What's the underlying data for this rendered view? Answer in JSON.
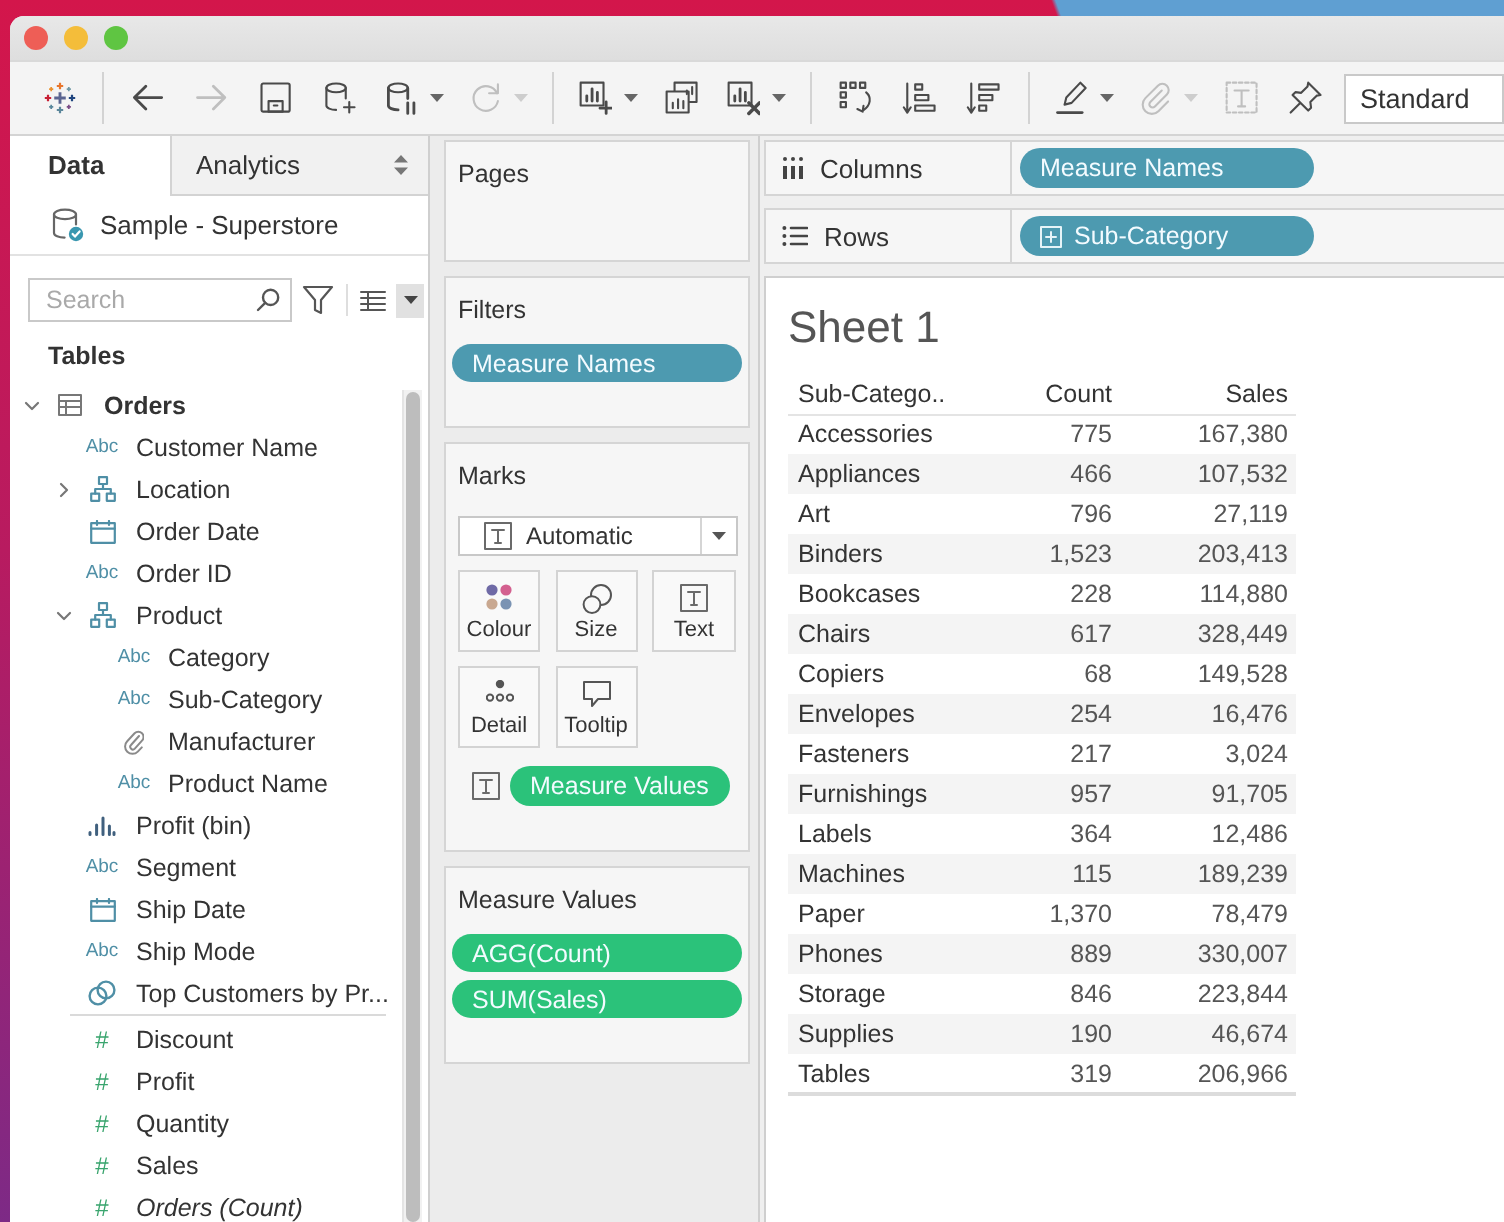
{
  "toolbar": {
    "tool_groups": [
      [
        {
          "kind": "logo",
          "disabled": false,
          "menu": false
        }
      ],
      [
        {
          "kind": "back",
          "disabled": false,
          "menu": false
        },
        {
          "kind": "forward",
          "disabled": true,
          "menu": false
        },
        {
          "kind": "save",
          "disabled": false,
          "menu": false
        },
        {
          "kind": "new_data_source",
          "disabled": false,
          "menu": false
        },
        {
          "kind": "pause_updates",
          "disabled": false,
          "menu": true
        },
        {
          "kind": "refresh",
          "disabled": true,
          "menu": true
        }
      ],
      [
        {
          "kind": "new_worksheet",
          "disabled": false,
          "menu": true
        },
        {
          "kind": "duplicate",
          "disabled": false,
          "menu": false
        },
        {
          "kind": "clear",
          "disabled": false,
          "menu": true
        }
      ],
      [
        {
          "kind": "swap",
          "disabled": false,
          "menu": false
        },
        {
          "kind": "sort_ascending",
          "disabled": false,
          "menu": false
        },
        {
          "kind": "sort_descending",
          "disabled": false,
          "menu": false
        }
      ],
      [
        {
          "kind": "highlight",
          "disabled": false,
          "menu": true
        },
        {
          "kind": "group",
          "disabled": true,
          "menu": true
        },
        {
          "kind": "labels",
          "disabled": true,
          "menu": false
        },
        {
          "kind": "pin",
          "disabled": false,
          "menu": false
        }
      ]
    ],
    "fit": {
      "value": "Standard"
    }
  },
  "data_pane": {
    "tabs": [
      {
        "label": "Data",
        "selected": true
      },
      {
        "label": "Analytics",
        "selected": false
      }
    ],
    "data_source": "Sample - Superstore",
    "search": {
      "placeholder": "Search"
    },
    "heading": "Tables",
    "tables": [
      {
        "name": "Orders",
        "kind": "table",
        "expanded": true,
        "children": [
          {
            "name": "Customer Name",
            "kind": "string",
            "glyph": "Abc"
          },
          {
            "name": "Location",
            "kind": "hierarchy",
            "expanded": false
          },
          {
            "name": "Order Date",
            "kind": "date"
          },
          {
            "name": "Order ID",
            "kind": "string",
            "glyph": "Abc"
          },
          {
            "name": "Product",
            "kind": "hierarchy",
            "expanded": true,
            "children": [
              {
                "name": "Category",
                "kind": "string",
                "glyph": "Abc"
              },
              {
                "name": "Sub-Category",
                "kind": "string",
                "glyph": "Abc"
              },
              {
                "name": "Manufacturer",
                "kind": "group"
              },
              {
                "name": "Product Name",
                "kind": "string",
                "glyph": "Abc"
              }
            ]
          },
          {
            "name": "Profit (bin)",
            "kind": "bin"
          },
          {
            "name": "Segment",
            "kind": "string",
            "glyph": "Abc"
          },
          {
            "name": "Ship Date",
            "kind": "date"
          },
          {
            "name": "Ship Mode",
            "kind": "string",
            "glyph": "Abc"
          },
          {
            "name": "Top Customers by Pr...",
            "kind": "set"
          },
          {
            "name": "Discount",
            "kind": "measure",
            "glyph": "#"
          },
          {
            "name": "Profit",
            "kind": "measure",
            "glyph": "#"
          },
          {
            "name": "Quantity",
            "kind": "measure",
            "glyph": "#"
          },
          {
            "name": "Sales",
            "kind": "measure",
            "glyph": "#"
          },
          {
            "name": "Orders (Count)",
            "kind": "count_measure",
            "glyph": "#"
          }
        ]
      }
    ]
  },
  "cards": [
    {
      "title": "Pages"
    },
    {
      "title": "Filters",
      "pills": [
        {
          "label": "Measure Names",
          "kind": "discrete"
        }
      ]
    },
    {
      "title": "Marks",
      "mark_type": "Automatic",
      "buttons": [
        {
          "label": "Colour",
          "kind": "color"
        },
        {
          "label": "Size",
          "kind": "size"
        },
        {
          "label": "Text",
          "kind": "text"
        },
        {
          "label": "Detail",
          "kind": "detail"
        },
        {
          "label": "Tooltip",
          "kind": "tooltip"
        }
      ],
      "encodings": [
        {
          "kind": "text",
          "pills": [
            {
              "label": "Measure Values",
              "kind": "continuous"
            }
          ]
        }
      ]
    },
    {
      "title": "Measure Values",
      "pills": [
        {
          "label": "AGG(Count)",
          "kind": "continuous"
        },
        {
          "label": "SUM(Sales)",
          "kind": "continuous"
        }
      ]
    }
  ],
  "shelves": [
    {
      "label": "Columns",
      "kind": "columns",
      "pills": [
        {
          "label": "Measure Names",
          "kind": "discrete",
          "expandable": false
        }
      ]
    },
    {
      "label": "Rows",
      "kind": "rows",
      "pills": [
        {
          "label": "Sub-Category",
          "kind": "discrete",
          "expandable": true
        }
      ]
    }
  ],
  "sheet": {
    "title": "Sheet 1",
    "table": {
      "columns": [
        "Sub-Catego..",
        "Count",
        "Sales"
      ],
      "rows": [
        [
          "Accessories",
          "775",
          "167,380"
        ],
        [
          "Appliances",
          "466",
          "107,532"
        ],
        [
          "Art",
          "796",
          "27,119"
        ],
        [
          "Binders",
          "1,523",
          "203,413"
        ],
        [
          "Bookcases",
          "228",
          "114,880"
        ],
        [
          "Chairs",
          "617",
          "328,449"
        ],
        [
          "Copiers",
          "68",
          "149,528"
        ],
        [
          "Envelopes",
          "254",
          "16,476"
        ],
        [
          "Fasteners",
          "217",
          "3,024"
        ],
        [
          "Furnishings",
          "957",
          "91,705"
        ],
        [
          "Labels",
          "364",
          "12,486"
        ],
        [
          "Machines",
          "115",
          "189,239"
        ],
        [
          "Paper",
          "1,370",
          "78,479"
        ],
        [
          "Phones",
          "889",
          "330,007"
        ],
        [
          "Storage",
          "846",
          "223,844"
        ],
        [
          "Supplies",
          "190",
          "46,674"
        ],
        [
          "Tables",
          "319",
          "206,966"
        ]
      ]
    }
  }
}
